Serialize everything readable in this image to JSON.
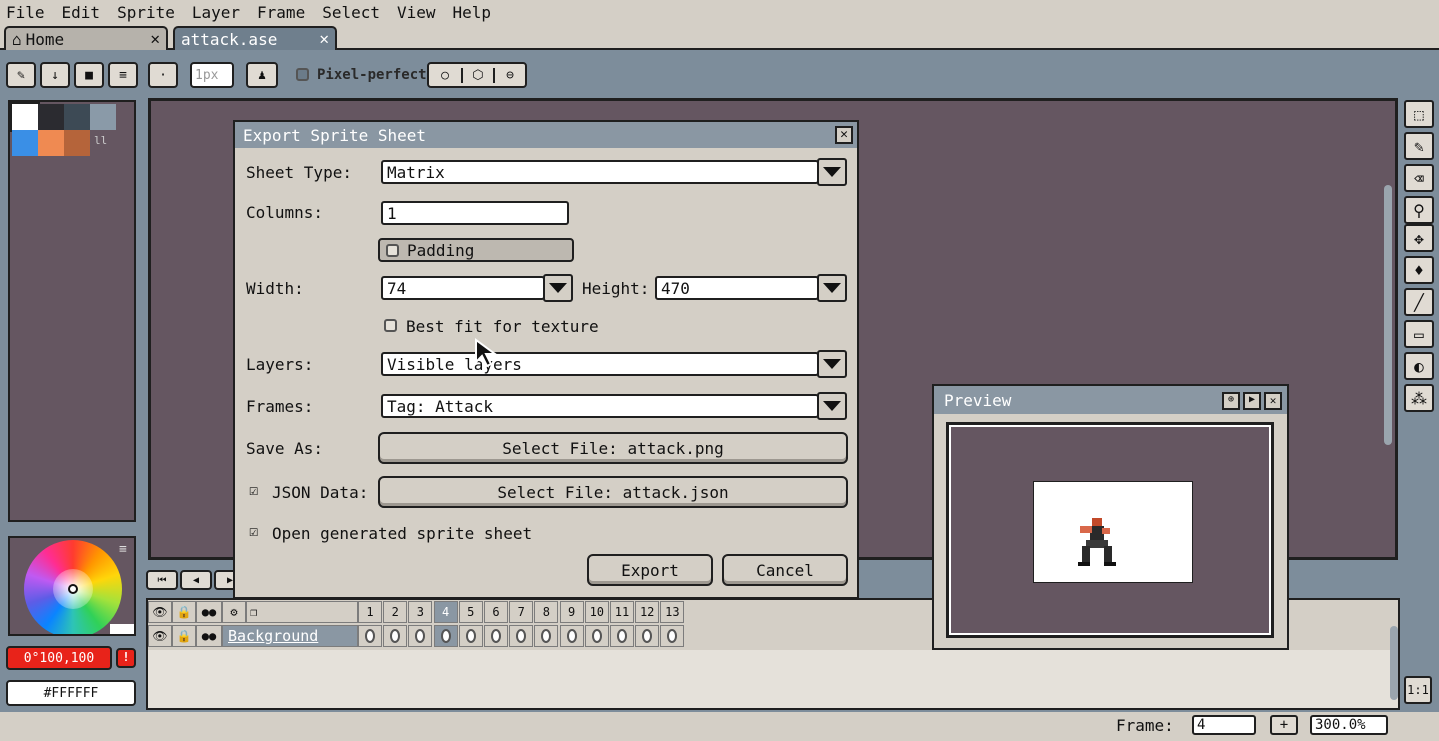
{
  "menu": [
    "File",
    "Edit",
    "Sprite",
    "Layer",
    "Frame",
    "Select",
    "View",
    "Help"
  ],
  "tabs": {
    "home": "Home",
    "file": "attack.ase",
    "close": "✕"
  },
  "toolbar": {
    "brush_size": "1px",
    "pixel_perfect": "Pixel-perfect"
  },
  "palette": {
    "colors": [
      "#ffffff",
      "#2b2b30",
      "#3d4a55",
      "#8a9aa8",
      "#3a8fe6",
      "#ef8a52",
      "#b5643a"
    ]
  },
  "color_bar": {
    "foreground": "0°100,100",
    "background": "#FFFFFF",
    "fg_color": "#e8231a"
  },
  "dialog": {
    "title": "Export Sprite Sheet",
    "sheet_type_label": "Sheet Type:",
    "sheet_type_value": "Matrix",
    "columns_label": "Columns:",
    "columns_value": "1",
    "padding_label": "Padding",
    "width_label": "Width:",
    "width_value": "74",
    "height_label": "Height:",
    "height_value": "470",
    "best_fit_label": "Best fit for texture",
    "layers_label": "Layers:",
    "layers_value": "Visible layers",
    "frames_label": "Frames:",
    "frames_value": "Tag: Attack",
    "save_as_label": "Save As:",
    "save_as_button": "Select File: attack.png",
    "json_label": "JSON Data:",
    "json_button": "Select File: attack.json",
    "open_generated_label": "Open generated sprite sheet",
    "export_button": "Export",
    "cancel_button": "Cancel"
  },
  "preview": {
    "title": "Preview"
  },
  "timeline": {
    "layer_name": "Background",
    "frames": [
      "1",
      "2",
      "3",
      "4",
      "5",
      "6",
      "7",
      "8",
      "9",
      "10",
      "11",
      "12",
      "13"
    ],
    "current_frame": "4"
  },
  "status": {
    "frame_label": "Frame:",
    "frame_value": "4",
    "zoom": "300.0%",
    "add": "+",
    "ratio": "1:1"
  }
}
